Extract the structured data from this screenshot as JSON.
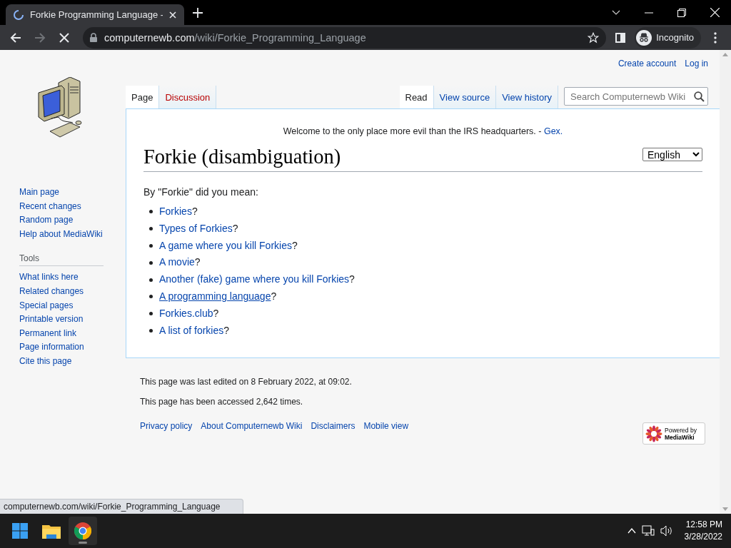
{
  "browser": {
    "tab_title": "Forkie Programming Language -",
    "loading": true,
    "url_domain": "computernewb.com",
    "url_path": "/wiki/Forkie_Programming_Language",
    "profile_label": "Incognito"
  },
  "personal_links": [
    "Create account",
    "Log in"
  ],
  "left_tabs": [
    {
      "label": "Page",
      "selected": true
    },
    {
      "label": "Discussion",
      "selected": false
    }
  ],
  "right_tabs": [
    {
      "label": "Read",
      "selected": true
    },
    {
      "label": "View source",
      "selected": false
    },
    {
      "label": "View history",
      "selected": false
    }
  ],
  "search": {
    "placeholder": "Search Computernewb Wiki"
  },
  "site_notice": {
    "text": "Welcome to the only place more evil than the IRS headquarters. - ",
    "link": "Gex."
  },
  "language_select": "English",
  "title": "Forkie (disambiguation)",
  "intro": "By \"Forkie\" did you mean:",
  "options": [
    {
      "link": "Forkies",
      "suffix": "?",
      "hovered": false
    },
    {
      "link": "Types of Forkies",
      "suffix": "?",
      "hovered": false
    },
    {
      "link": "A game where you kill Forkies",
      "suffix": "?",
      "hovered": false
    },
    {
      "link": "A movie",
      "suffix": "?",
      "hovered": false
    },
    {
      "link": "Another (fake) game where you kill Forkies",
      "suffix": "?",
      "hovered": false
    },
    {
      "link": "A programming language",
      "suffix": "?",
      "hovered": true
    },
    {
      "link": "Forkies.club",
      "suffix": "?",
      "hovered": false
    },
    {
      "link": "A list of forkies",
      "suffix": "?",
      "hovered": false
    }
  ],
  "sidebar": {
    "navigation": [
      "Main page",
      "Recent changes",
      "Random page",
      "Help about MediaWiki"
    ],
    "tools_heading": "Tools",
    "tools": [
      "What links here",
      "Related changes",
      "Special pages",
      "Printable version",
      "Permanent link",
      "Page information",
      "Cite this page"
    ]
  },
  "footer": {
    "info": [
      "This page was last edited on 8 February 2022, at 09:02.",
      "This page has been accessed 2,642 times."
    ],
    "links": [
      "Privacy policy",
      "About Computernewb Wiki",
      "Disclaimers",
      "Mobile view"
    ],
    "badge": {
      "line_1": "Powered by",
      "line_2": "MediaWiki"
    }
  },
  "status_url": "computernewb.com/wiki/Forkie_Programming_Language",
  "taskbar": {
    "time": "12:58 PM",
    "date": "3/28/2022"
  }
}
